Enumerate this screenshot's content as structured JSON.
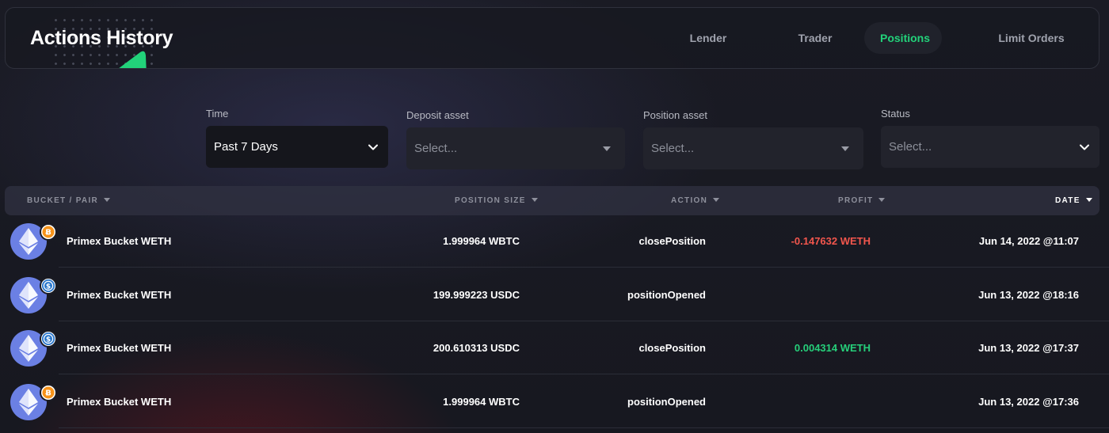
{
  "header": {
    "title": "Actions History",
    "tabs": [
      {
        "label": "Lender",
        "active": false
      },
      {
        "label": "Trader",
        "active": false
      },
      {
        "label": "Positions",
        "active": true
      },
      {
        "label": "Limit Orders",
        "active": false
      }
    ]
  },
  "filters": {
    "time": {
      "label": "Time",
      "value": "Past 7 Days"
    },
    "deposit_asset": {
      "label": "Deposit asset",
      "placeholder": "Select..."
    },
    "position_asset": {
      "label": "Position asset",
      "placeholder": "Select..."
    },
    "status": {
      "label": "Status",
      "placeholder": "Select..."
    }
  },
  "table": {
    "columns": {
      "bucket": "BUCKET / PAIR",
      "size": "POSITION SIZE",
      "action": "ACTION",
      "profit": "PROFIT",
      "date": "DATE"
    },
    "rows": [
      {
        "bucket": "Primex Bucket WETH",
        "badge": "bitcoin-icon",
        "size": "1.999964 WBTC",
        "action": "closePosition",
        "profit": "-0.147632 WETH",
        "profit_sign": "negative",
        "date": "Jun 14, 2022 @11:07"
      },
      {
        "bucket": "Primex Bucket WETH",
        "badge": "usdc-icon",
        "size": "199.999223 USDC",
        "action": "positionOpened",
        "profit": "",
        "profit_sign": "none",
        "date": "Jun 13, 2022 @18:16"
      },
      {
        "bucket": "Primex Bucket WETH",
        "badge": "usdc-icon",
        "size": "200.610313 USDC",
        "action": "closePosition",
        "profit": "0.004314 WETH",
        "profit_sign": "positive",
        "date": "Jun 13, 2022 @17:37"
      },
      {
        "bucket": "Primex Bucket WETH",
        "badge": "bitcoin-icon",
        "size": "1.999964 WBTC",
        "action": "positionOpened",
        "profit": "",
        "profit_sign": "none",
        "date": "Jun 13, 2022 @17:36"
      }
    ]
  },
  "colors": {
    "accent_green": "#22d27a",
    "profit_negative": "#f2564d",
    "profit_positive": "#26cf7a",
    "eth_blue": "#6b80e4",
    "bitcoin_orange": "#f7931a",
    "usdc_blue": "#2775ca"
  }
}
